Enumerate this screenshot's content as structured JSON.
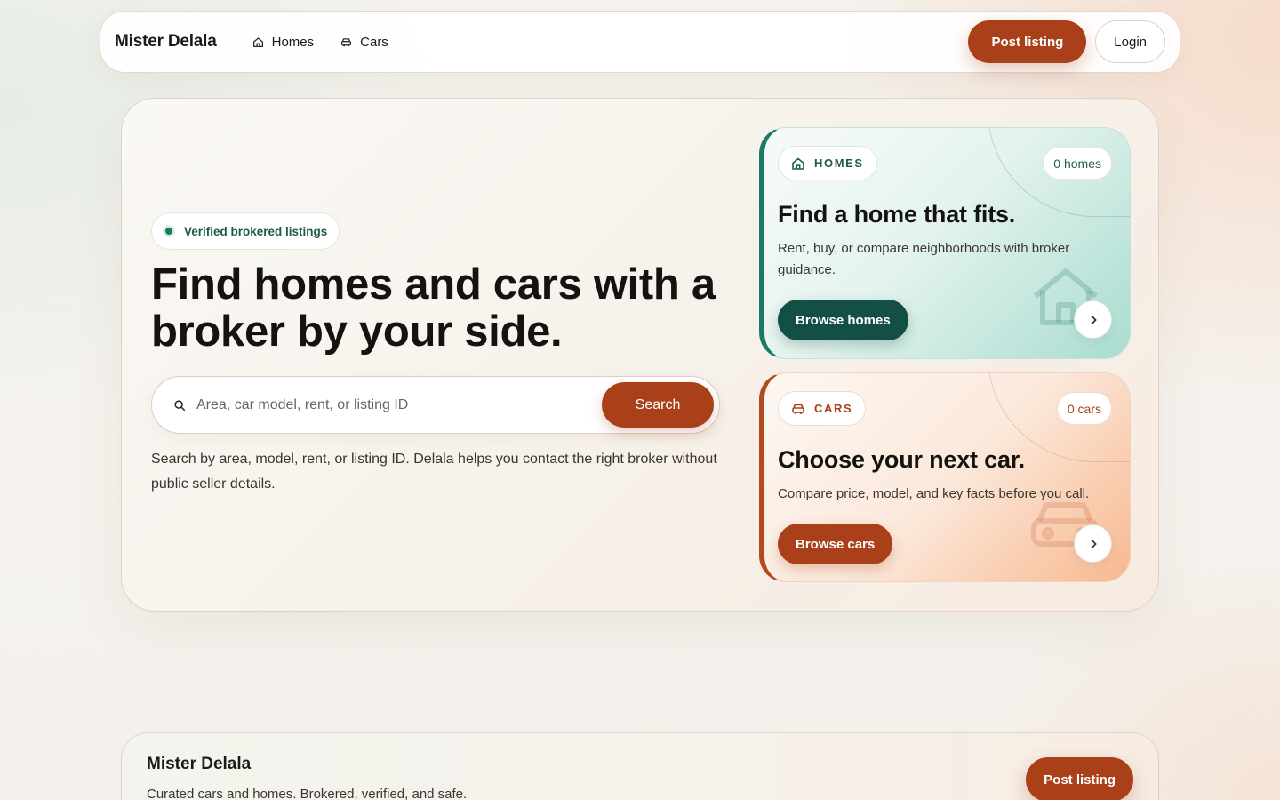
{
  "nav": {
    "brand": "Mister Delala",
    "links": [
      {
        "label": "Homes",
        "icon": "home-icon"
      },
      {
        "label": "Cars",
        "icon": "car-icon"
      }
    ],
    "post_listing": "Post listing",
    "login": "Login"
  },
  "hero": {
    "badge": "Verified brokered listings",
    "headline": "Find homes and cars with a broker by your side.",
    "search": {
      "placeholder": "Area, car model, rent, or listing ID",
      "value": "",
      "button": "Search"
    },
    "description": "Search by area, model, rent, or listing ID. Delala helps you contact the right broker without public seller details."
  },
  "cards": {
    "homes": {
      "chip": "HOMES",
      "count": "0 homes",
      "title": "Find a home that fits.",
      "description": "Rent, buy, or compare neighborhoods with broker guidance.",
      "button": "Browse homes"
    },
    "cars": {
      "chip": "CARS",
      "count": "0 cars",
      "title": "Choose your next car.",
      "description": "Compare price, model, and key facts before you call.",
      "button": "Browse cars"
    }
  },
  "footer": {
    "brand": "Mister Delala",
    "tagline": "Curated cars and homes. Brokered, verified, and safe.",
    "post_listing": "Post listing"
  },
  "colors": {
    "accent_rust": "#a9401a",
    "accent_teal": "#144f45",
    "badge_green": "#1b7a64"
  }
}
